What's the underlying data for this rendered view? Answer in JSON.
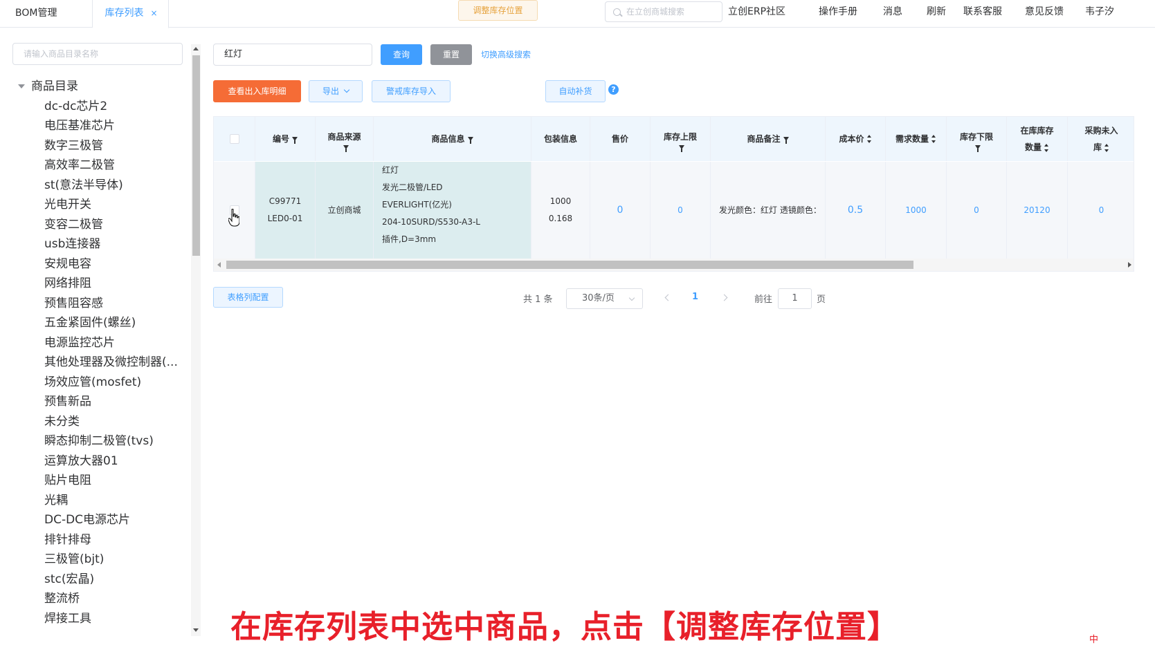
{
  "tabs": [
    {
      "label": "BOM管理"
    },
    {
      "label": "库存列表",
      "close": "×"
    }
  ],
  "header": {
    "search_placeholder": "在立创商城搜索",
    "nav": [
      "立创ERP社区",
      "操作手册",
      "消息",
      "刷新",
      "联系客服",
      "意见反馈",
      "韦子汐"
    ]
  },
  "sidebar": {
    "search_placeholder": "请输入商品目录名称",
    "root": "商品目录",
    "items": [
      "dc-dc芯片2",
      "电压基准芯片",
      "数字三极管",
      "高效率二极管",
      "st(意法半导体)",
      "光电开关",
      "变容二极管",
      "usb连接器",
      "安规电容",
      "网络排阻",
      "预售阻容感",
      "五金紧固件(螺丝)",
      "电源监控芯片",
      "其他处理器及微控制器(...",
      "场效应管(mosfet)",
      "预售新品",
      "未分类",
      "瞬态抑制二极管(tvs)",
      "运算放大器01",
      "贴片电阻",
      "光耦",
      "DC-DC电源芯片",
      "排针排母",
      "三极管(bjt)",
      "stc(宏晶)",
      "整流桥",
      "焊接工具"
    ]
  },
  "search": {
    "value": "红灯",
    "query_label": "查询",
    "reset_label": "重置",
    "advanced_label": "切换高级搜索"
  },
  "toolbar": {
    "detail_label": "查看出入库明细",
    "export_label": "导出",
    "warn_import_label": "警戒库存导入",
    "adjust_location_label": "调整库存位置",
    "auto_replenish_label": "自动补货",
    "help": "?"
  },
  "table": {
    "headers": {
      "code": "编号",
      "source_line1": "商品来源",
      "info": "商品信息",
      "package": "包装信息",
      "price": "售价",
      "upper_line1": "库存上限",
      "remark": "商品备注",
      "cost": "成本价",
      "demand": "需求数量",
      "lower_line1": "库存下限",
      "instock_line1": "在库库存",
      "instock_line2": "数量",
      "purchase_line1": "采购未入",
      "purchase_line2": "库"
    },
    "row": {
      "code_line1": "C99771",
      "code_line2": "LED0-01",
      "source": "立创商城",
      "info_line1": "红灯",
      "info_line2": "发光二极管/LED",
      "info_line3": "EVERLIGHT(亿光)",
      "info_line4": "204-10SURD/S530-A3-L",
      "info_line5": "插件,D=3mm",
      "package_line1": "1000",
      "package_line2": "0.168",
      "price": "0",
      "upper": "0",
      "remark": "发光颜色：红灯 透镜颜色：",
      "cost": "0.5",
      "demand": "1000",
      "lower": "0",
      "instock": "20120",
      "purchase": "0"
    }
  },
  "footer": {
    "col_config_label": "表格列配置",
    "total": "共 1 条",
    "page_size": "30条/页",
    "current_page": "1",
    "goto_label": "前往",
    "goto_value": "1",
    "page_suffix": "页"
  },
  "caption": "在库存列表中选中商品，点击【调整库存位置】",
  "corner_mark": "中"
}
